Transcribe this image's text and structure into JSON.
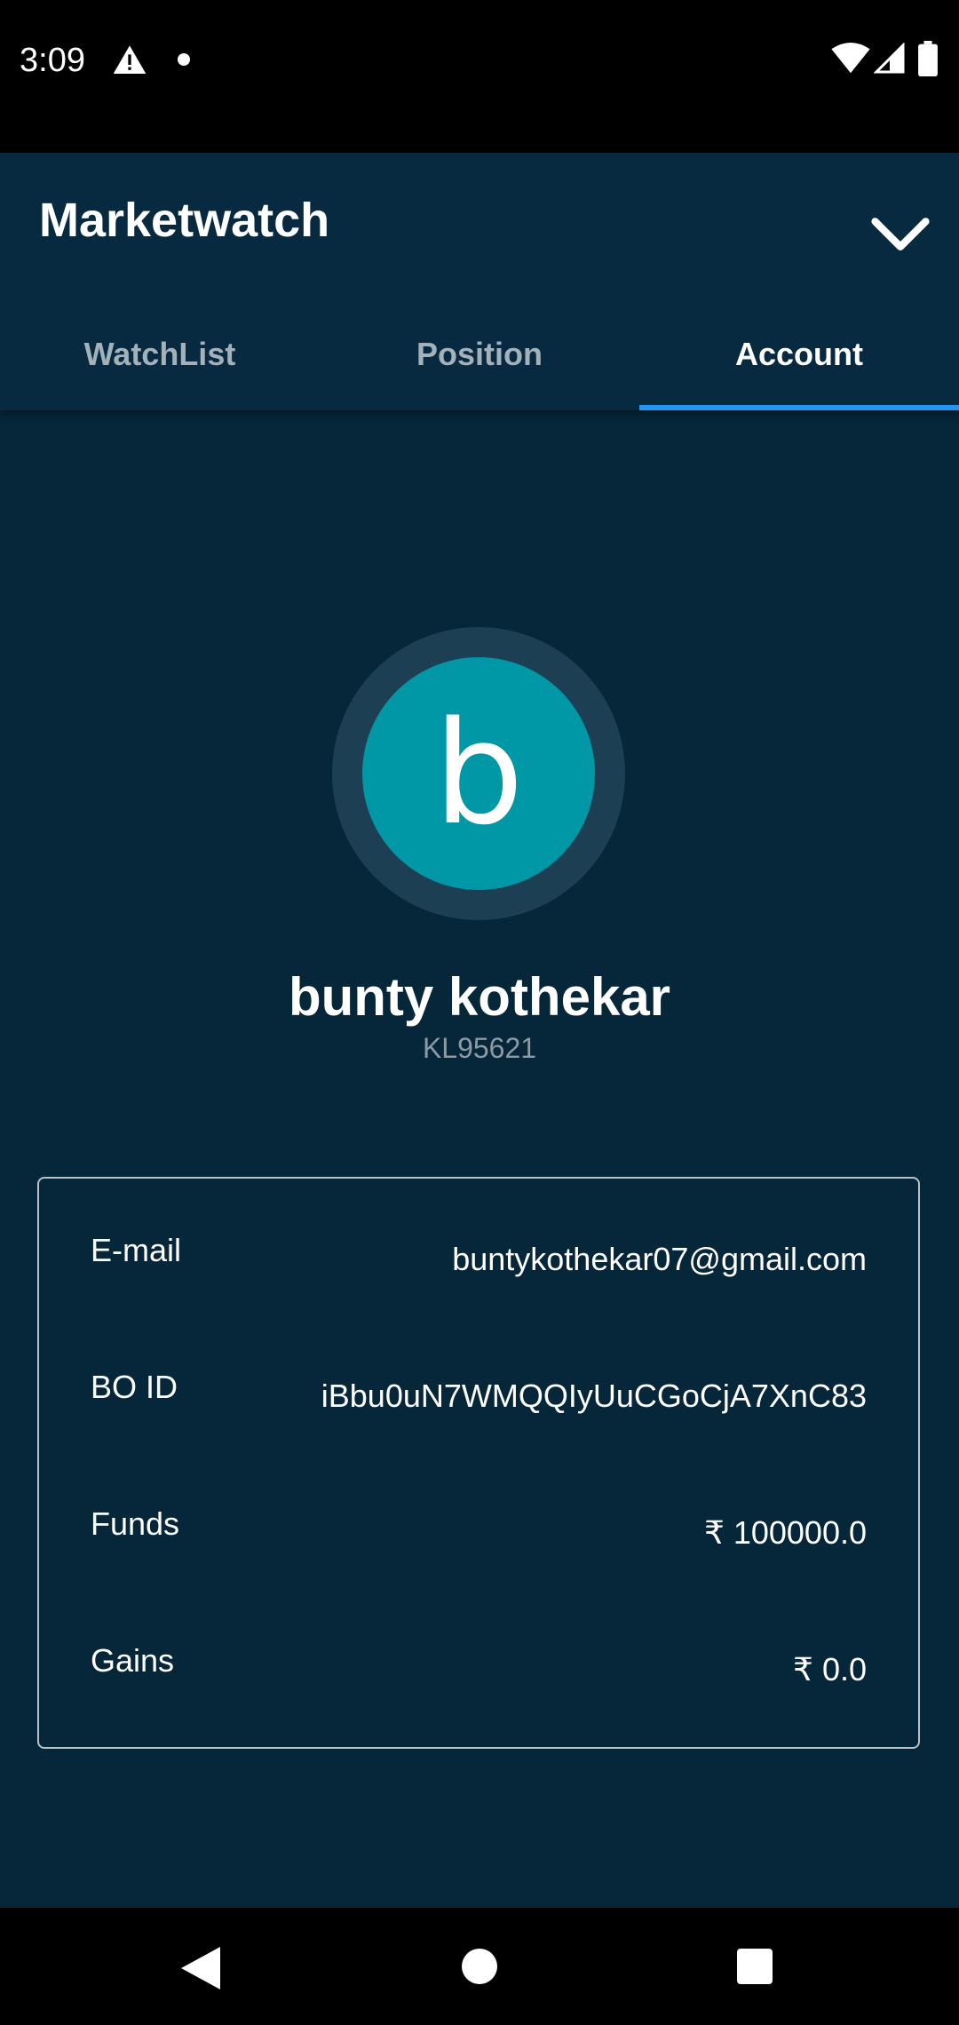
{
  "status_bar": {
    "time": "3:09",
    "icons": [
      "warning-icon",
      "notification-dot-icon",
      "wifi-icon",
      "signal-icon",
      "battery-icon"
    ]
  },
  "app_bar": {
    "title": "Marketwatch",
    "collapse_icon": "chevron-down-icon"
  },
  "tabs": [
    {
      "label": "WatchList",
      "active": false
    },
    {
      "label": "Position",
      "active": false
    },
    {
      "label": "Account",
      "active": true
    }
  ],
  "profile": {
    "avatar_letter": "b",
    "name": "bunty kothekar",
    "client_id": "KL95621"
  },
  "account_info": [
    {
      "label": "E-mail",
      "value": "buntykothekar07@gmail.com"
    },
    {
      "label": "BO ID",
      "value": "iBbu0uN7WMQQIyUuCGoCjA7XnC83"
    },
    {
      "label": "Funds",
      "value": "₹ 100000.0"
    },
    {
      "label": "Gains",
      "value": "₹ 0.0"
    }
  ],
  "nav_bar": {
    "icons": [
      "back-icon",
      "home-icon",
      "recents-icon"
    ]
  },
  "colors": {
    "background": "#06263a",
    "app_bar": "#072a41",
    "tab_indicator": "#2196f3",
    "avatar": "#0097a7",
    "avatar_ring": "#1d3f54"
  }
}
